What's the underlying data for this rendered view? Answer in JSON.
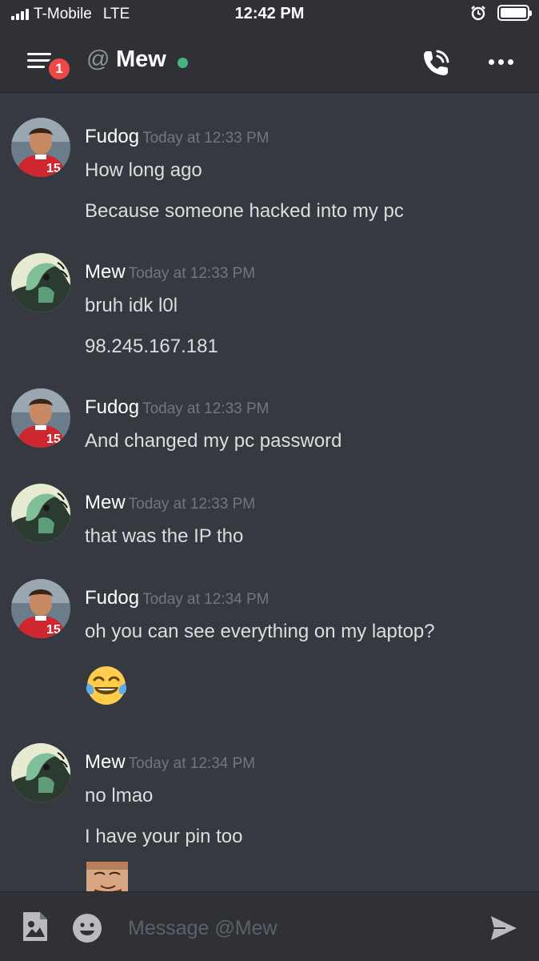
{
  "status_bar": {
    "carrier": "T-Mobile",
    "network": "LTE",
    "time": "12:42 PM"
  },
  "header": {
    "notification_count": "1",
    "at_symbol": "@",
    "channel_name": "Mew",
    "online_color": "#43b581",
    "icons": [
      "menu-icon",
      "phone-call-icon",
      "more-options-icon"
    ]
  },
  "messages": [
    {
      "author": "Fudog",
      "time": "Today at 12:33 PM",
      "lines": [
        "How long ago",
        "Because someone hacked into my pc"
      ]
    },
    {
      "author": "Mew",
      "time": "Today at 12:33 PM",
      "lines": [
        "bruh idk l0l",
        "98.245.167.181"
      ]
    },
    {
      "author": "Fudog",
      "time": "Today at 12:33 PM",
      "lines": [
        "And changed my pc password"
      ]
    },
    {
      "author": "Mew",
      "time": "Today at 12:33 PM",
      "lines": [
        "that was the IP tho"
      ]
    },
    {
      "author": "Fudog",
      "time": "Today at 12:34 PM",
      "lines": [
        "oh you can see everything on my laptop?"
      ],
      "emoji": "face-with-tears-of-joy"
    },
    {
      "author": "Mew",
      "time": "Today at 12:34 PM",
      "lines": [
        "no lmao",
        "I have your pin too"
      ]
    }
  ],
  "composer": {
    "placeholder": "Message @Mew",
    "icons": [
      "image-upload-icon",
      "emoji-picker-icon",
      "send-icon"
    ]
  },
  "colors": {
    "background": "#36393f",
    "bars": "#2f3136",
    "badge": "#f04747",
    "timestamp": "#72767d"
  }
}
